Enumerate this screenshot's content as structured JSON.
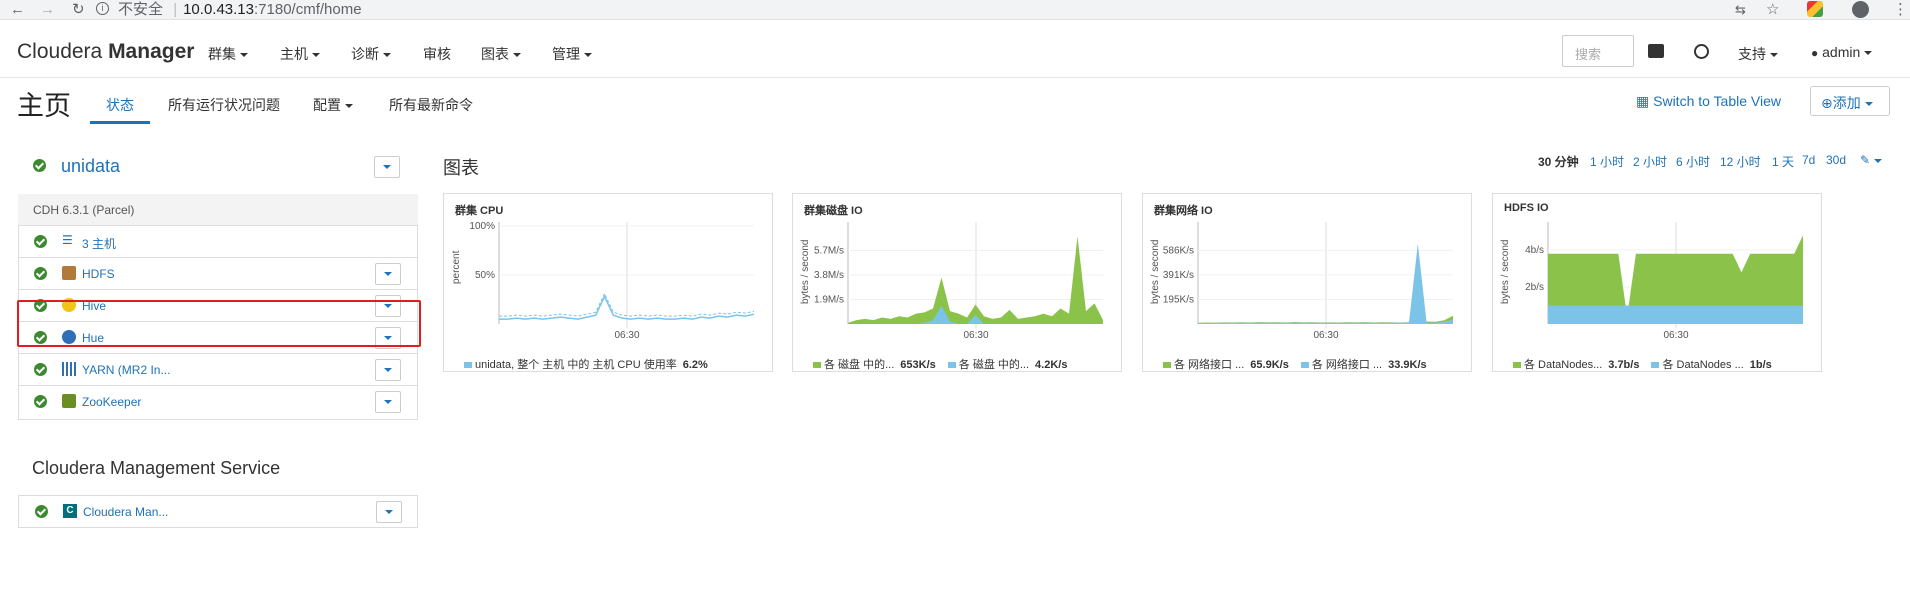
{
  "browser": {
    "insecure_label": "不安全",
    "url_host": "10.0.43.13",
    "url_rest": ":7180/cmf/home"
  },
  "nav": {
    "brand_light": "Cloudera ",
    "brand_bold": "Manager",
    "menus": [
      "群集",
      "主机",
      "诊断",
      "审核",
      "图表",
      "管理"
    ],
    "search_placeholder": "搜索",
    "support": "支持",
    "user": "admin"
  },
  "page": {
    "title": "主页",
    "tabs": [
      "状态",
      "所有运行状况问题",
      "配置",
      "所有最新命令"
    ],
    "switch_view": "Switch to Table View",
    "add": "添加"
  },
  "cluster": {
    "name": "unidata",
    "version": "CDH 6.3.1 (Parcel)",
    "services": [
      {
        "label": "3 主机",
        "icon": "list-icon"
      },
      {
        "label": "HDFS",
        "icon": "hdfs-icon"
      },
      {
        "label": "Hive",
        "icon": "hive-icon"
      },
      {
        "label": "Hue",
        "icon": "hue-icon"
      },
      {
        "label": "YARN (MR2 In...",
        "icon": "yarn-icon"
      },
      {
        "label": "ZooKeeper",
        "icon": "zookeeper-icon"
      }
    ]
  },
  "cms": {
    "title": "Cloudera Management Service",
    "item": "Cloudera Man..."
  },
  "charts_section": {
    "title": "图表",
    "ranges": [
      "30 分钟",
      "1 小时",
      "2 小时",
      "6 小时",
      "12 小时",
      "1 天",
      "7d",
      "30d"
    ],
    "selected_range": "30 分钟"
  },
  "chart_data": [
    {
      "type": "line",
      "title": "群集 CPU",
      "ylabel": "percent",
      "yticks": [
        "100%",
        "50%"
      ],
      "xtick": "06:30",
      "series": [
        {
          "name": "unidata, 整个 主机 中的 主机 CPU 使用率",
          "value_label": "6.2%",
          "color": "#7cc3e8",
          "values": [
            5,
            5,
            6,
            5,
            6,
            5,
            6,
            7,
            6,
            5,
            7,
            9,
            28,
            9,
            6,
            5,
            6,
            5,
            6,
            5,
            5,
            6,
            5,
            7,
            6,
            8,
            7,
            9,
            8,
            10
          ]
        }
      ]
    },
    {
      "type": "area",
      "title": "群集磁盘 IO",
      "ylabel": "bytes / second",
      "yticks": [
        "5.7M/s",
        "3.8M/s",
        "1.9M/s"
      ],
      "xtick": "06:30",
      "series": [
        {
          "name": "各 磁盘 中的...",
          "value_label": "653K/s",
          "color": "#8bc34a",
          "values": [
            0.1,
            0.3,
            0.4,
            0.3,
            0.5,
            0.4,
            0.6,
            0.5,
            0.8,
            0.9,
            1.2,
            3.6,
            1.0,
            0.8,
            0.5,
            1.5,
            0.6,
            0.4,
            0.5,
            1.1,
            0.4,
            0.5,
            0.6,
            0.8,
            0.6,
            1.2,
            0.8,
            6.8,
            1.0,
            1.6,
            0.3
          ]
        },
        {
          "name": "各 磁盘 中的...",
          "value_label": "4.2K/s",
          "color": "#7cc3e8",
          "values": [
            0,
            0,
            0,
            0,
            0,
            0,
            0,
            0,
            0,
            0.1,
            0.3,
            1.4,
            0.2,
            0,
            0,
            0.7,
            0,
            0,
            0,
            0,
            0,
            0,
            0,
            0,
            0,
            0,
            0,
            0,
            0,
            0,
            0
          ]
        }
      ]
    },
    {
      "type": "area",
      "title": "群集网络 IO",
      "ylabel": "bytes / second",
      "yticks": [
        "586K/s",
        "391K/s",
        "195K/s"
      ],
      "xtick": "06:30",
      "series": [
        {
          "name": "各 网络接口 ...",
          "value_label": "65.9K/s",
          "color": "#8bc34a",
          "values": [
            10,
            12,
            11,
            13,
            12,
            14,
            12,
            15,
            13,
            14,
            12,
            16,
            13,
            14,
            12,
            13,
            12,
            14,
            13,
            15,
            12,
            14,
            13,
            12,
            14,
            15,
            20,
            18,
            30,
            66
          ]
        },
        {
          "name": "各 网络接口 ...",
          "value_label": "33.9K/s",
          "color": "#7cc3e8",
          "values": [
            8,
            9,
            8,
            10,
            9,
            11,
            9,
            10,
            9,
            10,
            9,
            11,
            10,
            9,
            10,
            9,
            10,
            9,
            10,
            11,
            9,
            10,
            9,
            10,
            14,
            640,
            12,
            10,
            20,
            34
          ]
        }
      ]
    },
    {
      "type": "area",
      "title": "HDFS IO",
      "ylabel": "bytes / second",
      "yticks": [
        "4b/s",
        "2b/s"
      ],
      "xtick": "06:30",
      "series": [
        {
          "name": "各 DataNodes...",
          "value_label": "3.7b/s",
          "color": "#8bc34a",
          "values": [
            3.8,
            3.8,
            3.8,
            3.8,
            3.8,
            3.8,
            3.8,
            3.8,
            3.8,
            0.4,
            3.8,
            3.8,
            3.8,
            3.8,
            3.8,
            3.8,
            3.8,
            3.8,
            3.8,
            3.8,
            3.8,
            3.8,
            2.8,
            3.8,
            3.8,
            3.8,
            3.8,
            3.8,
            3.8,
            4.8
          ]
        },
        {
          "name": "各 DataNodes ...",
          "value_label": "1b/s",
          "color": "#7cc3e8",
          "values": [
            1,
            1,
            1,
            1,
            1,
            1,
            1,
            1,
            1,
            1,
            1,
            1,
            1,
            1,
            1,
            1,
            1,
            1,
            1,
            1,
            1,
            1,
            1,
            1,
            1,
            1,
            1,
            1,
            1,
            1
          ]
        }
      ]
    }
  ]
}
